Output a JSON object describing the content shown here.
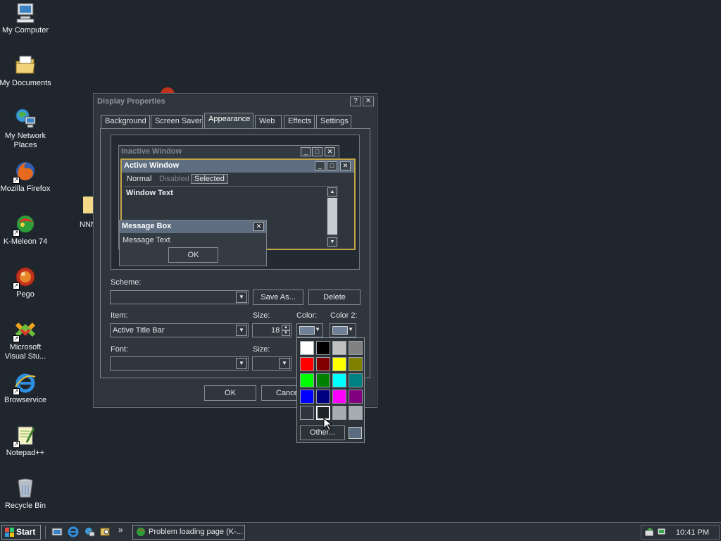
{
  "desktop": {
    "icons": [
      {
        "label": "My Computer",
        "icon": "computer-icon"
      },
      {
        "label": "My Documents",
        "icon": "folder-icon"
      },
      {
        "label": "My Network Places",
        "icon": "network-icon"
      },
      {
        "label": "Mozilla Firefox",
        "icon": "firefox-icon"
      },
      {
        "label": "K-Meleon 74",
        "icon": "kmeleon-icon"
      },
      {
        "label": "Pego",
        "icon": "pego-icon"
      },
      {
        "label": "Microsoft Visual Stu...",
        "icon": "visual-studio-icon"
      },
      {
        "label": "Browservice",
        "icon": "ie-icon"
      },
      {
        "label": "Notepad++",
        "icon": "notepad-icon"
      },
      {
        "label": "Recycle Bin",
        "icon": "recycle-bin-icon"
      }
    ],
    "partial_icon_label": "NNN"
  },
  "window": {
    "title": "Display Properties",
    "help": "?",
    "close": "✕",
    "tabs": [
      "Background",
      "Screen Saver",
      "Appearance",
      "Web",
      "Effects",
      "Settings"
    ],
    "selected_tab": "Appearance",
    "preview": {
      "inactive_title": "Inactive Window",
      "active_title": "Active Window",
      "menu_normal": "Normal",
      "menu_disabled": "Disabled",
      "menu_selected": "Selected",
      "window_text": "Window Text",
      "msgbox_title": "Message Box",
      "msgbox_text": "Message Text",
      "msgbox_ok": "OK"
    },
    "scheme_label": "Scheme:",
    "scheme_value": "",
    "save_as": "Save As...",
    "delete": "Delete",
    "item_label": "Item:",
    "item_value": "Active Title Bar",
    "size_label": "Size:",
    "size_value": "18",
    "color_label": "Color:",
    "color2_label": "Color 2:",
    "font_label": "Font:",
    "font_size_label": "Size:",
    "ok": "OK",
    "cancel": "Cance"
  },
  "palette": {
    "colors": [
      "#ffffff",
      "#000000",
      "#c0c0c0",
      "#808080",
      "#ff0000",
      "#800000",
      "#ffff00",
      "#808000",
      "#00ff00",
      "#008000",
      "#00ffff",
      "#008080",
      "#0000ff",
      "#000080",
      "#ff00ff",
      "#800080",
      "#2f363d",
      "#1e2328",
      "#a7acb1",
      "#a7acb1"
    ],
    "selected_index": 17,
    "other_label": "Other...",
    "other_color": "#5a6b7e"
  },
  "taskbar": {
    "start": "Start",
    "task": "Problem loading page (K-...",
    "clock": "10:41 PM",
    "chevron": "»"
  }
}
